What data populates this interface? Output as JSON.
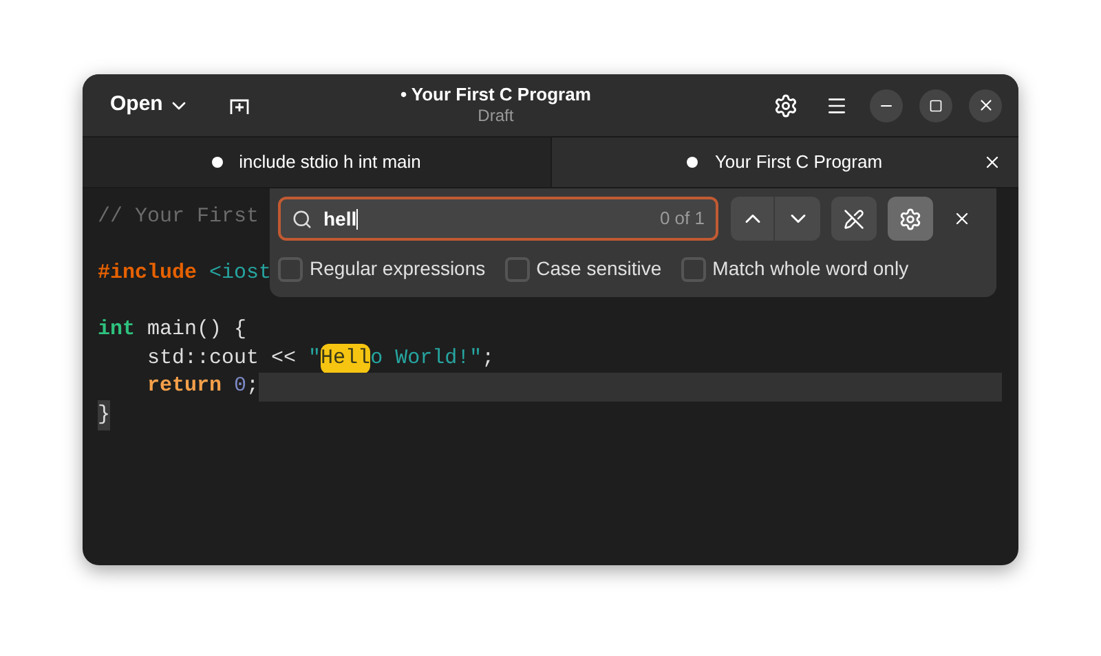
{
  "window": {
    "title": "• Your First C Program",
    "subtitle": "Draft",
    "open_button": "Open"
  },
  "tabs": [
    {
      "label": "include stdio h int main",
      "selected": false,
      "modified": true
    },
    {
      "label": "Your First C Program",
      "selected": true,
      "modified": true
    }
  ],
  "editor": {
    "lines": [
      {
        "current": false,
        "tokens": [
          {
            "kind": "comment",
            "text": "// Your First"
          }
        ]
      },
      {
        "current": false
      },
      {
        "current": false,
        "tokens": [
          {
            "kind": "preproc",
            "text": "#include"
          },
          {
            "kind": "string",
            "text": " <iost"
          }
        ]
      },
      {
        "current": false
      },
      {
        "current": false,
        "tokens": [
          {
            "kind": "type",
            "text": "int"
          },
          {
            "kind": "plain",
            "text": " main() {"
          }
        ]
      },
      {
        "current": false,
        "tokens": [
          {
            "kind": "plain",
            "text": "    std::cout << "
          },
          {
            "kind": "string",
            "text": "\""
          },
          {
            "kind": "match",
            "text": "Hell"
          },
          {
            "kind": "string",
            "text": "o World!\""
          },
          {
            "kind": "plain",
            "text": ";"
          }
        ]
      },
      {
        "current": true,
        "tokens": [
          {
            "kind": "keyword",
            "text": "    return"
          },
          {
            "kind": "number",
            "text": " 0"
          },
          {
            "kind": "plain",
            "text": ";"
          }
        ]
      },
      {
        "current": false,
        "tokens": [
          {
            "kind": "bracket",
            "text": "}"
          }
        ]
      }
    ]
  },
  "search": {
    "value": "hell",
    "count": "0 of 1",
    "options_selected": true,
    "options": [
      {
        "label": "Regular expressions",
        "checked": false
      },
      {
        "label": "Case sensitive",
        "checked": false
      },
      {
        "label": "Match whole word only",
        "checked": false
      }
    ]
  }
}
